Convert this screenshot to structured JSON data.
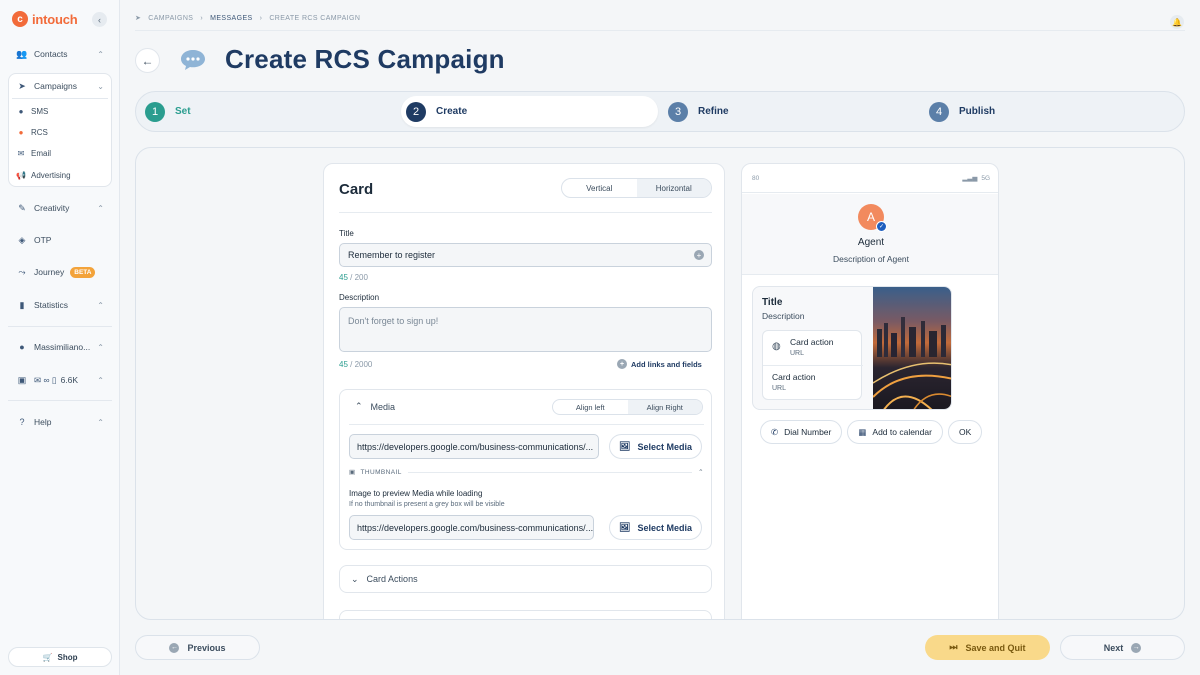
{
  "app": {
    "logo": "intouch"
  },
  "sidebar": {
    "contacts": "Contacts",
    "campaigns": "Campaigns",
    "campaign_items": [
      "SMS",
      "RCS",
      "Email",
      "Advertising"
    ],
    "creativity": "Creativity",
    "otp": "OTP",
    "journey": "Journey",
    "journey_badge": "BETA",
    "statistics": "Statistics",
    "user": "Massimiliano...",
    "credits": "6.6K",
    "help": "Help",
    "shop": "Shop"
  },
  "breadcrumb": [
    "CAMPAIGNS",
    "MESSAGES",
    "CREATE RCS CAMPAIGN"
  ],
  "page": {
    "title": "Create RCS Campaign"
  },
  "stepper": [
    {
      "num": "1",
      "label": "Set"
    },
    {
      "num": "2",
      "label": "Create"
    },
    {
      "num": "3",
      "label": "Refine"
    },
    {
      "num": "4",
      "label": "Publish"
    }
  ],
  "form": {
    "heading": "Card",
    "orientation": {
      "options": [
        "Vertical",
        "Horizontal"
      ],
      "selected": "Horizontal"
    },
    "title_label": "Title",
    "title_value": "Remember to register",
    "title_count": "45",
    "title_max": "/ 200",
    "description_label": "Description",
    "description_placeholder": "Don't forget to sign up!",
    "description_count": "45",
    "description_max": "/ 2000",
    "add_links": "Add links and fields",
    "media": {
      "title": "Media",
      "align": {
        "options": [
          "Align left",
          "Align Right"
        ],
        "selected": "Align Right"
      },
      "url": "https://developers.google.com/business-communications/...",
      "select_label": "Select Media",
      "thumbnail_label": "THUMBNAIL",
      "thumbnail_text": "Image to preview Media while loading",
      "thumbnail_sub": "If no thumbnail is present a grey box will be visible",
      "thumbnail_url": "https://developers.google.com/business-communications/..."
    },
    "card_actions": "Card Actions"
  },
  "preview": {
    "status_left": "80",
    "status_right": "5G",
    "agent_initial": "A",
    "agent_name": "Agent",
    "agent_desc": "Description of Agent",
    "card_title": "Title",
    "card_desc": "Description",
    "actions": [
      {
        "title": "Card action",
        "sub": "URL"
      },
      {
        "title": "Card action",
        "sub": "URL"
      }
    ],
    "chips": [
      "Dial Number",
      "Add to calendar",
      "OK"
    ]
  },
  "footer": {
    "previous": "Previous",
    "save": "Save and Quit",
    "next": "Next"
  }
}
